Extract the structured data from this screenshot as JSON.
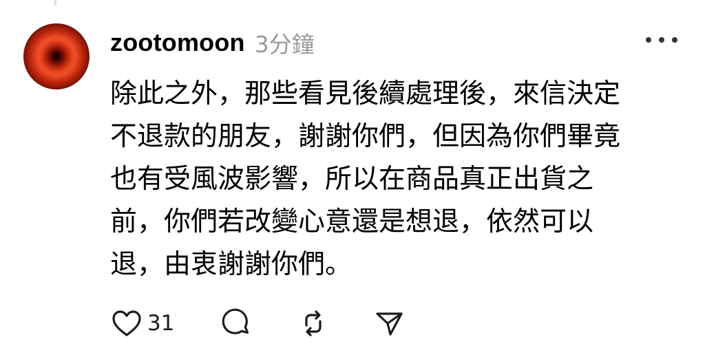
{
  "post": {
    "username": "zootomoon",
    "timestamp": "3分鐘",
    "content_lines": [
      "除此之外，那些看見後續處理後，來信決定",
      "不退款的朋友，謝謝你們，但因為你們畢竟",
      "也有受風波影響，所以在商品真正出貨之",
      "前，你們若改變心意還是想退，依然可以",
      "退，由衷謝謝你們。"
    ]
  },
  "actions": {
    "like_icon": "heart-icon",
    "like_count": "31",
    "reply_icon": "comment-bubble-icon",
    "repost_icon": "repost-icon",
    "share_icon": "send-icon"
  },
  "menu": {
    "icon": "more-horizontal-icon"
  },
  "colors": {
    "text": "#000000",
    "muted": "#9a9a9a",
    "icon": "#1c1c1c",
    "thread_line": "#d9d9d9",
    "avatar_glow": "#e8421e"
  }
}
